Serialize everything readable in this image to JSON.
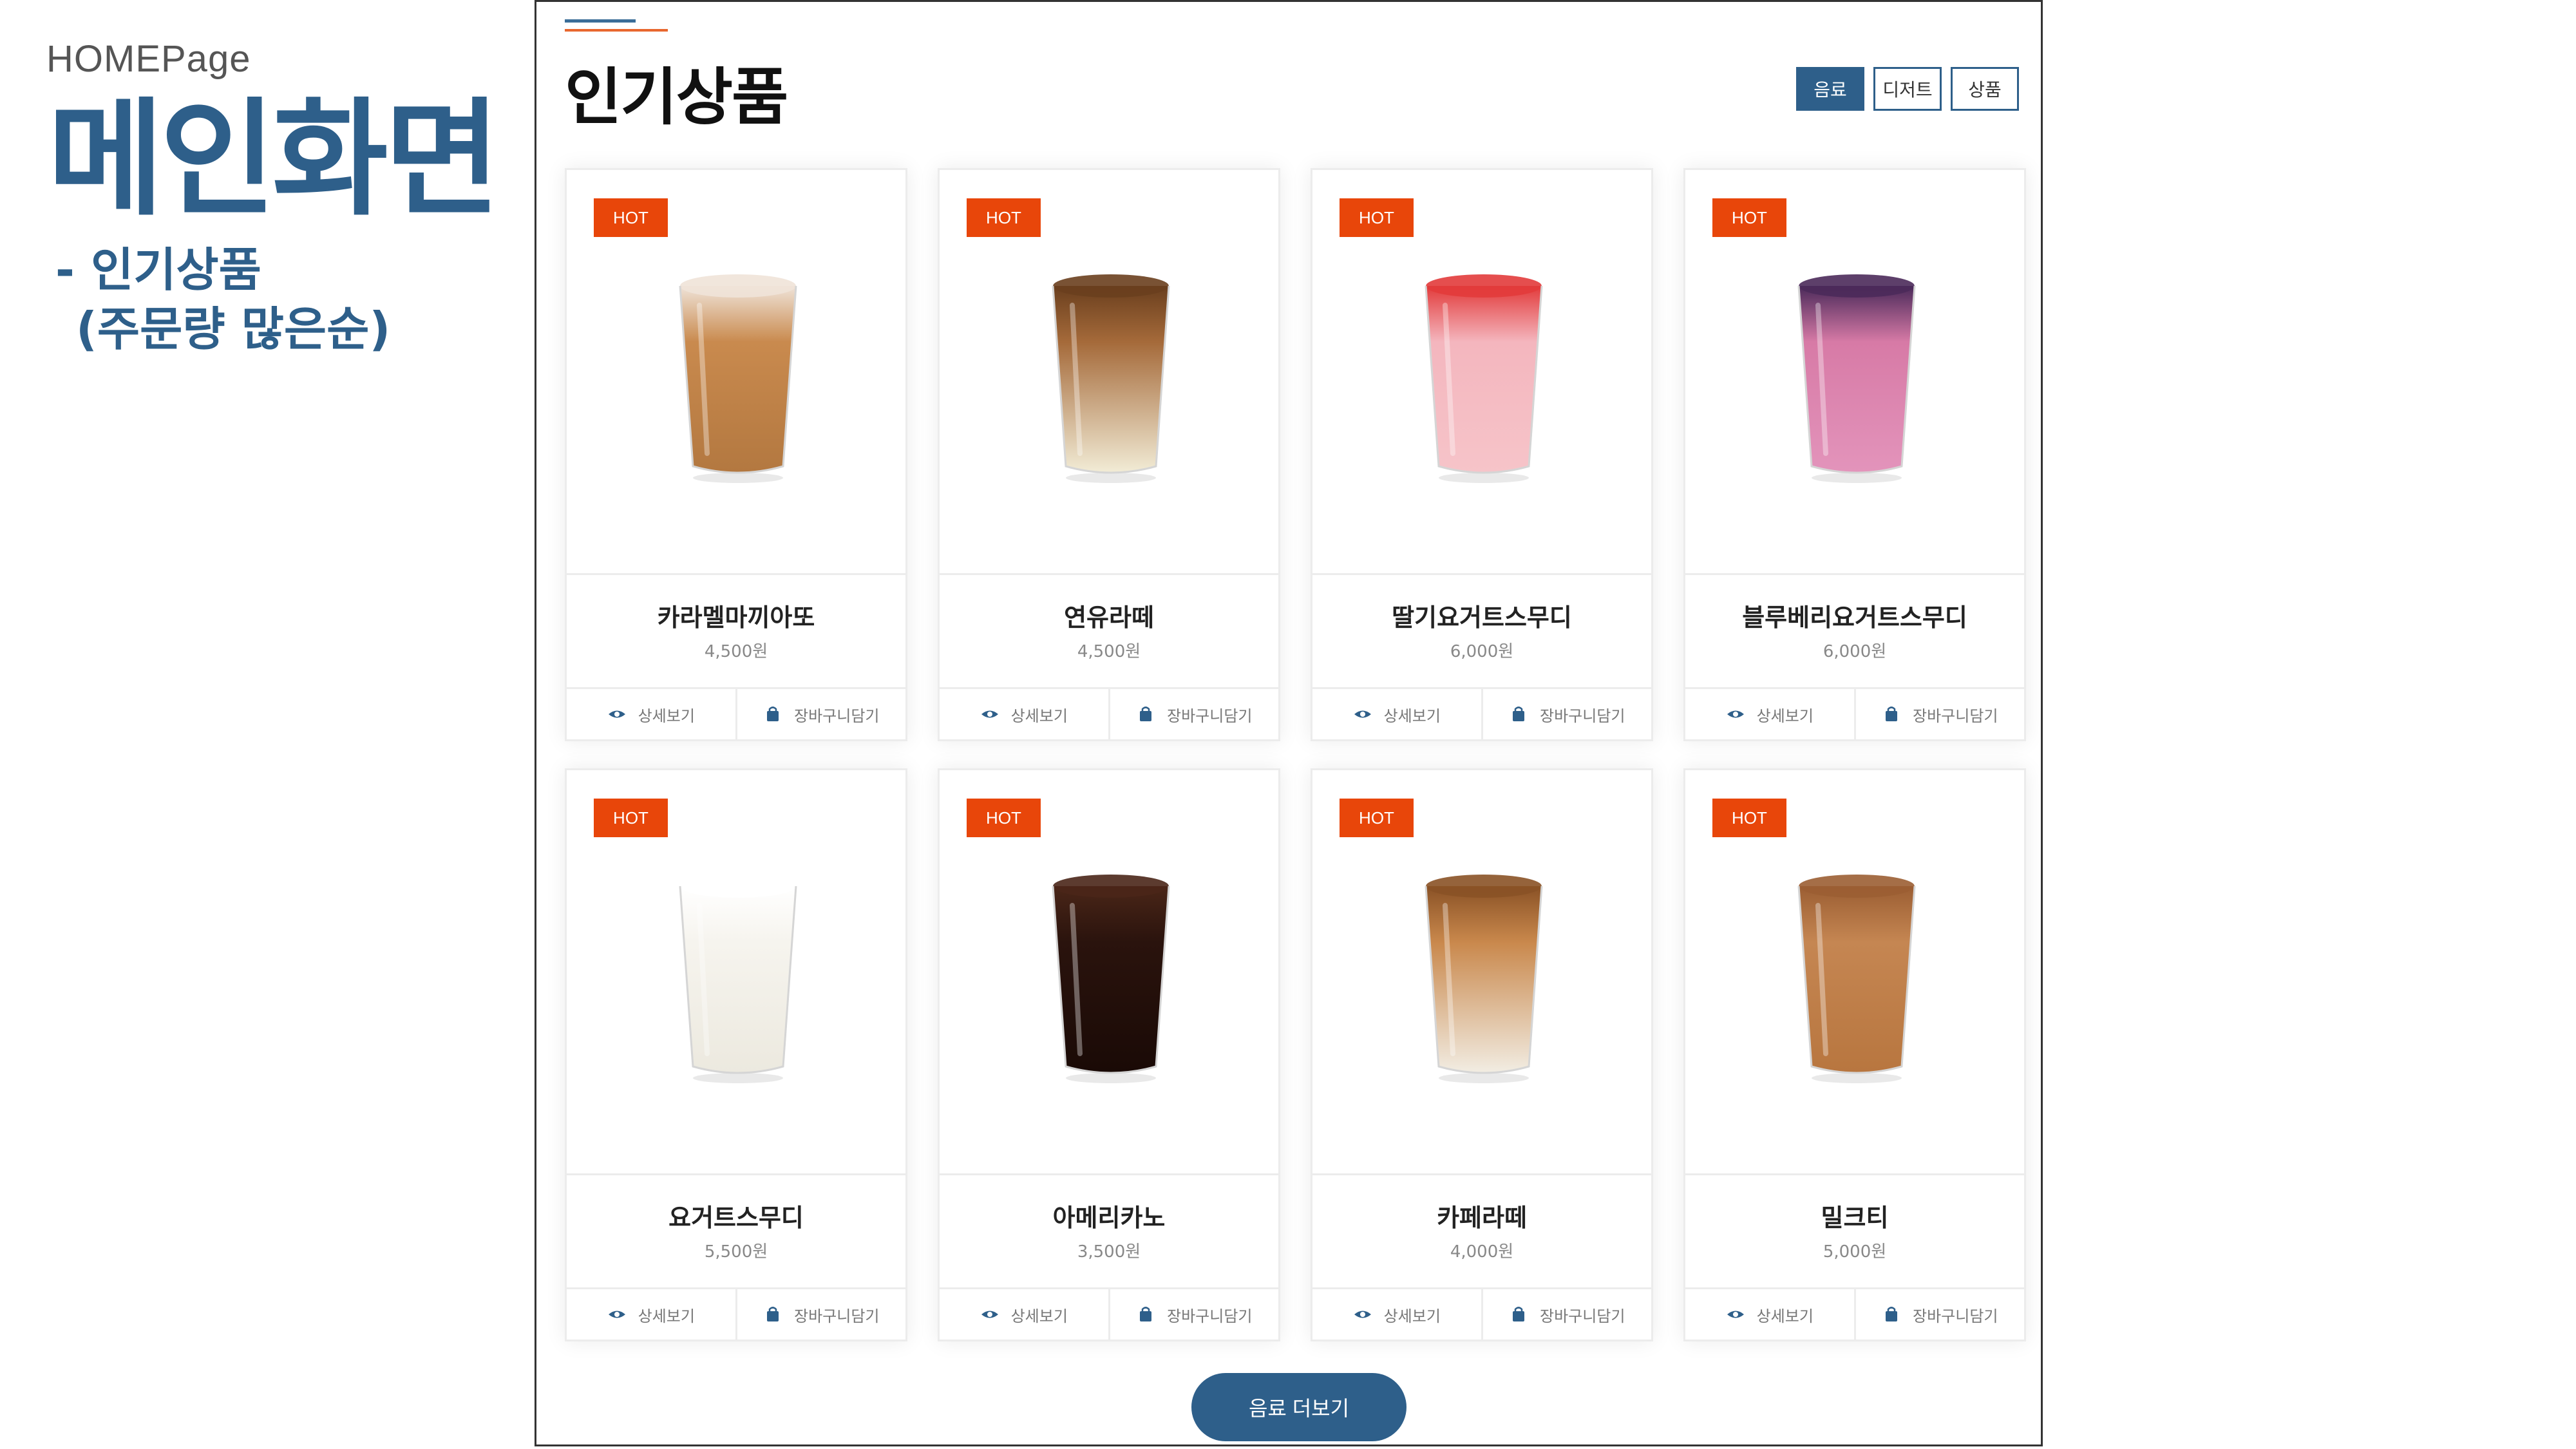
{
  "slide": {
    "label": "HOMEPage",
    "title": "메인화면",
    "subtitle_line1": "- 인기상품",
    "subtitle_line2": "(주문량 많은순)"
  },
  "page": {
    "title": "인기상품",
    "tabs": [
      {
        "label": "음료",
        "active": true
      },
      {
        "label": "디저트",
        "active": false
      },
      {
        "label": "상품",
        "active": false
      }
    ],
    "products": [
      {
        "badge": "HOT",
        "name": "카라멜마끼아또",
        "price": "4,500원",
        "detail_label": "상세보기",
        "cart_label": "장바구니담기",
        "drink": {
          "liquid": "#c98a4e",
          "top": "#efe3d8",
          "bottom": "#b37840"
        }
      },
      {
        "badge": "HOT",
        "name": "연유라떼",
        "price": "4,500원",
        "detail_label": "상세보기",
        "cart_label": "장바구니담기",
        "drink": {
          "liquid": "#a56a3a",
          "top": "#6a3f1e",
          "bottom": "#f2ecd6"
        }
      },
      {
        "badge": "HOT",
        "name": "딸기요거트스무디",
        "price": "6,000원",
        "detail_label": "상세보기",
        "cart_label": "장바구니담기",
        "drink": {
          "liquid": "#f4b6be",
          "top": "#e23b3b",
          "bottom": "#f6c4c9"
        }
      },
      {
        "badge": "HOT",
        "name": "블루베리요거트스무디",
        "price": "6,000원",
        "detail_label": "상세보기",
        "cart_label": "장바구니담기",
        "drink": {
          "liquid": "#d77aa6",
          "top": "#4b2a5a",
          "bottom": "#e394bb"
        }
      },
      {
        "badge": "HOT",
        "name": "요거트스무디",
        "price": "5,500원",
        "detail_label": "상세보기",
        "cart_label": "장바구니담기",
        "drink": {
          "liquid": "#f6f4ee",
          "top": "#ffffff",
          "bottom": "#ece9df"
        }
      },
      {
        "badge": "HOT",
        "name": "아메리카노",
        "price": "3,500원",
        "detail_label": "상세보기",
        "cart_label": "장바구니담기",
        "drink": {
          "liquid": "#2a130d",
          "top": "#4a2618",
          "bottom": "#1a0a06"
        }
      },
      {
        "badge": "HOT",
        "name": "카페라떼",
        "price": "4,000원",
        "detail_label": "상세보기",
        "cart_label": "장바구니담기",
        "drink": {
          "liquid": "#c9884c",
          "top": "#8a5226",
          "bottom": "#f2ede3"
        }
      },
      {
        "badge": "HOT",
        "name": "밀크티",
        "price": "5,000원",
        "detail_label": "상세보기",
        "cart_label": "장바구니담기",
        "drink": {
          "liquid": "#c58652",
          "top": "#9b5e33",
          "bottom": "#b8763f"
        }
      }
    ],
    "more_button": "음료 더보기"
  },
  "colors": {
    "brand": "#2e5f8a",
    "hot_badge": "#e8460a",
    "accent_line": "#e8672e"
  },
  "icons": {
    "detail": "eye-icon",
    "cart": "shopping-bag-icon"
  }
}
